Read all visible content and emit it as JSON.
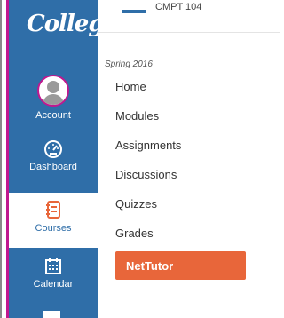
{
  "logo": {
    "text": "College"
  },
  "top": {
    "crumb": "CMPT 104"
  },
  "global_nav": [
    {
      "label": "Account",
      "icon": "user-avatar-icon"
    },
    {
      "label": "Dashboard",
      "icon": "speedometer-icon"
    },
    {
      "label": "Courses",
      "icon": "book-icon"
    },
    {
      "label": "Calendar",
      "icon": "calendar-icon"
    }
  ],
  "course_nav": {
    "term": "Spring 2016",
    "items": [
      "Home",
      "Modules",
      "Assignments",
      "Discussions",
      "Quizzes",
      "Grades"
    ],
    "active": "NetTutor"
  },
  "colors": {
    "rail": "#2f6ea8",
    "accent": "#c0188f",
    "active": "#e8663a"
  }
}
